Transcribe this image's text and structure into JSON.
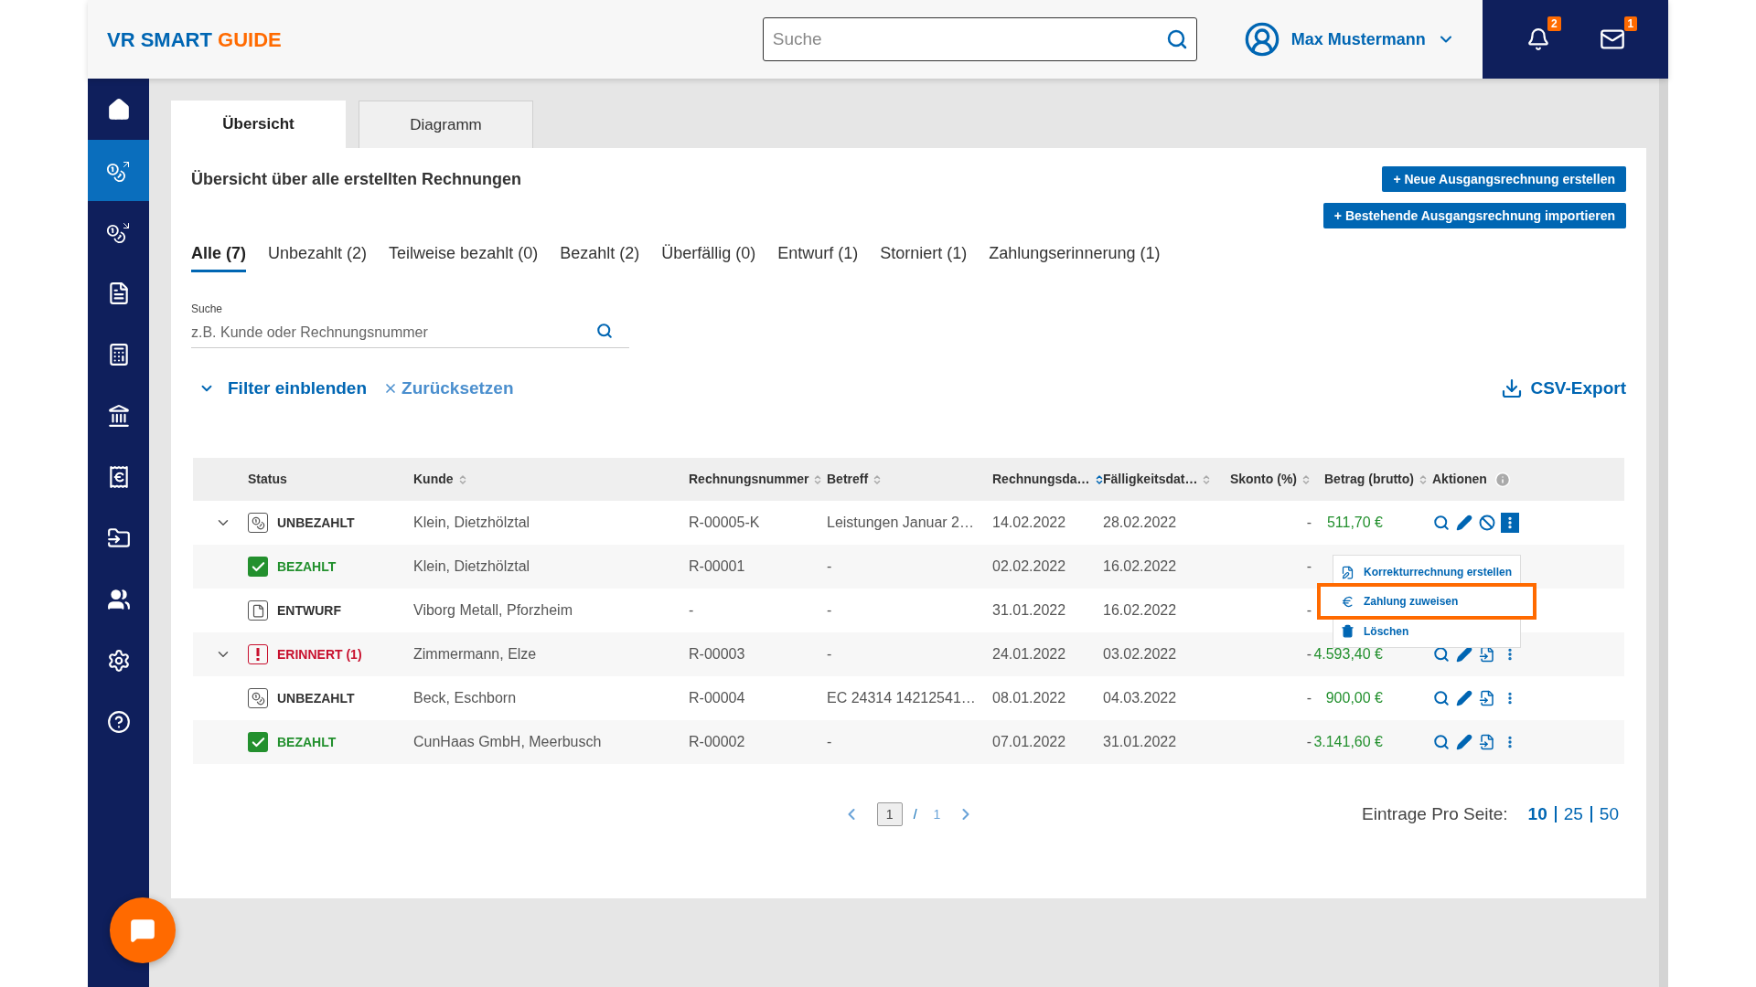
{
  "header": {
    "logo": {
      "part1": "VR SMART",
      "part2": "GUIDE"
    },
    "search": {
      "placeholder": "Suche"
    },
    "user": {
      "name": "Max Mustermann"
    },
    "notifications": {
      "count": "2"
    },
    "messages": {
      "count": "1"
    }
  },
  "sidebar": {
    "items": [
      {
        "kind": "home",
        "selected": false
      },
      {
        "kind": "outgoing",
        "selected": true
      },
      {
        "kind": "incoming",
        "selected": false
      },
      {
        "kind": "document",
        "selected": false
      },
      {
        "kind": "calculator",
        "selected": false
      },
      {
        "kind": "bank",
        "selected": false
      },
      {
        "kind": "receipt",
        "selected": false
      },
      {
        "kind": "folder",
        "selected": false
      },
      {
        "kind": "contacts",
        "selected": false
      },
      {
        "kind": "settings",
        "selected": false
      },
      {
        "kind": "help",
        "selected": false
      }
    ]
  },
  "tabs": [
    {
      "label": "Übersicht",
      "selected": true
    },
    {
      "label": "Diagramm",
      "selected": false
    }
  ],
  "panel": {
    "title": "Übersicht über alle erstellten Rechnungen",
    "buttons": [
      "+ Neue Ausgangsrechnung erstellen",
      "+ Bestehende Ausgangsrechnung importieren"
    ]
  },
  "filter_tabs": [
    {
      "label": "Alle (7)",
      "selected": true
    },
    {
      "label": "Unbezahlt (2)",
      "selected": false
    },
    {
      "label": "Teilweise bezahlt (0)",
      "selected": false
    },
    {
      "label": "Bezahlt (2)",
      "selected": false
    },
    {
      "label": "Überfällig (0)",
      "selected": false
    },
    {
      "label": "Entwurf (1)",
      "selected": false
    },
    {
      "label": "Storniert (1)",
      "selected": false
    },
    {
      "label": "Zahlungserinnerung (1)",
      "selected": false
    }
  ],
  "search": {
    "label": "Suche",
    "placeholder": "z.B. Kunde oder Rechnungsnummer"
  },
  "filter_toggle": "Filter einblenden",
  "reset": "Zurücksetzen",
  "export": "CSV-Export",
  "table": {
    "columns": [
      {
        "label": "Status",
        "sortable": false
      },
      {
        "label": "Kunde",
        "sortable": true,
        "sorted": false
      },
      {
        "label": "Rechnungsnummer",
        "sortable": true,
        "sorted": false
      },
      {
        "label": "Betreff",
        "sortable": true,
        "sorted": false
      },
      {
        "label": "Rechnungsda…",
        "sortable": true,
        "sorted": true
      },
      {
        "label": "Fälligkeitsdat…",
        "sortable": true,
        "sorted": false
      },
      {
        "label": "Skonto (%)",
        "sortable": true,
        "sorted": false
      },
      {
        "label": "Betrag (brutto)",
        "sortable": true,
        "sorted": false
      },
      {
        "label": "Aktionen",
        "sortable": false,
        "info": true
      }
    ],
    "rows": [
      {
        "expandable": true,
        "kind": "unpaid",
        "cells": [
          "UNBEZAHLT",
          "Klein, Dietzhölztal",
          "R-00005-K",
          "Leistungen Januar 2…",
          "14.02.2022",
          "28.02.2022",
          "-",
          "511,70 €"
        ],
        "actions": [
          {
            "kind": "view"
          },
          {
            "kind": "edit"
          },
          {
            "kind": "cancel"
          },
          {
            "kind": "more"
          }
        ],
        "menu_open": true
      },
      {
        "expandable": false,
        "kind": "paid",
        "cells": [
          "BEZAHLT",
          "Klein, Dietzhölztal",
          "R-00001",
          "-",
          "02.02.2022",
          "16.02.2022",
          "-"
        ],
        "menu_open": false
      },
      {
        "expandable": false,
        "kind": "draft",
        "cells": [
          "ENTWURF",
          "Viborg Metall, Pforzheim",
          "-",
          "-",
          "31.01.2022",
          "16.02.2022",
          "-"
        ],
        "menu_open": false
      },
      {
        "expandable": true,
        "kind": "reminded",
        "cells": [
          "ERINNERT (1)",
          "Zimmermann, Elze",
          "R-00003",
          "-",
          "24.01.2022",
          "03.02.2022",
          "-",
          "4.593,40 €"
        ],
        "actions": [
          {
            "kind": "view"
          },
          {
            "kind": "edit"
          },
          {
            "kind": "copy"
          },
          {
            "kind": "more"
          }
        ],
        "menu_open": false
      },
      {
        "expandable": false,
        "kind": "unpaid",
        "cells": [
          "UNBEZAHLT",
          "Beck, Eschborn",
          "R-00004",
          "EC 24314 14212541…",
          "08.01.2022",
          "04.03.2022",
          "-",
          "900,00 €"
        ],
        "actions": [
          {
            "kind": "view"
          },
          {
            "kind": "edit"
          },
          {
            "kind": "copy"
          },
          {
            "kind": "more"
          }
        ],
        "menu_open": false
      },
      {
        "expandable": false,
        "kind": "paid",
        "cells": [
          "BEZAHLT",
          "CunHaas GmbH, Meerbusch",
          "R-00002",
          "-",
          "07.01.2022",
          "31.01.2022",
          "-",
          "3.141,60 €"
        ],
        "actions": [
          {
            "kind": "view"
          },
          {
            "kind": "edit"
          },
          {
            "kind": "copy"
          },
          {
            "kind": "more"
          }
        ],
        "menu_open": false
      }
    ]
  },
  "row_menu": {
    "items": [
      {
        "kind": "correct",
        "label": "Korrekturrechnung erstellen",
        "highlighted": false
      },
      {
        "kind": "payment",
        "label": "Zahlung zuweisen",
        "highlighted": true
      },
      {
        "kind": "delete",
        "label": "Löschen",
        "highlighted": false
      }
    ]
  },
  "pagination": {
    "page": "1",
    "separator": "/",
    "total": "1",
    "page_size": {
      "label": "Eintrage Pro Seite:",
      "options": [
        {
          "label": "10",
          "selected": true
        },
        {
          "label": "25",
          "selected": false
        },
        {
          "label": "50",
          "selected": false
        }
      ]
    }
  }
}
